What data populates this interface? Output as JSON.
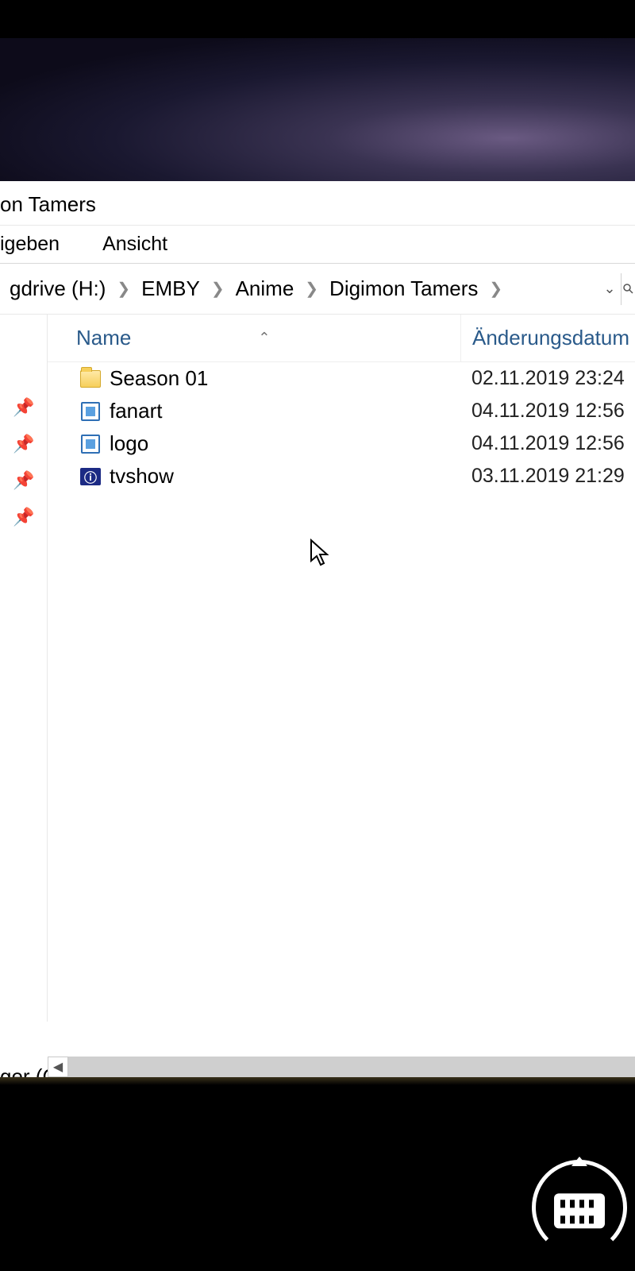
{
  "window": {
    "title_fragment": "on Tamers",
    "menu": {
      "share": "igeben",
      "view": "Ansicht"
    }
  },
  "breadcrumb": {
    "items": [
      "gdrive (H:)",
      "EMBY",
      "Anime",
      "Digimon Tamers"
    ]
  },
  "columns": {
    "name": "Name",
    "date": "Änderungsdatum"
  },
  "files": [
    {
      "icon": "folder",
      "name": "Season 01",
      "date": "02.11.2019 23:24"
    },
    {
      "icon": "image",
      "name": "fanart",
      "date": "04.11.2019 12:56"
    },
    {
      "icon": "image",
      "name": "logo",
      "date": "04.11.2019 12:56"
    },
    {
      "icon": "nfo",
      "name": "tvshow",
      "date": "03.11.2019 21:29"
    }
  ],
  "sidebar_fragment": "ger (C"
}
